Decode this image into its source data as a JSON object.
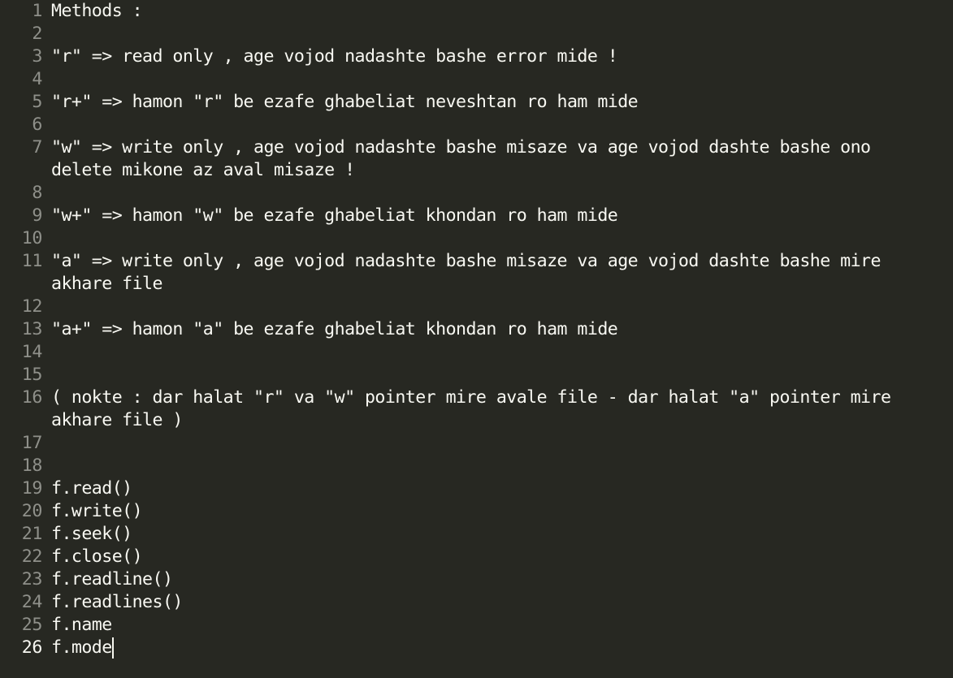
{
  "editor": {
    "lines": [
      {
        "num": "1",
        "text": "Methods :"
      },
      {
        "num": "2",
        "text": ""
      },
      {
        "num": "3",
        "text": "\"r\" => read only , age vojod nadashte bashe error mide !"
      },
      {
        "num": "4",
        "text": ""
      },
      {
        "num": "5",
        "text": "\"r+\" => hamon \"r\" be ezafe ghabeliat neveshtan ro ham mide"
      },
      {
        "num": "6",
        "text": ""
      },
      {
        "num": "7",
        "text": "\"w\" => write only , age vojod nadashte bashe misaze va age vojod dashte bashe ono\ndelete mikone az aval misaze !"
      },
      {
        "num": "8",
        "text": ""
      },
      {
        "num": "9",
        "text": "\"w+\" => hamon \"w\" be ezafe ghabeliat khondan ro ham mide"
      },
      {
        "num": "10",
        "text": ""
      },
      {
        "num": "11",
        "text": "\"a\" => write only , age vojod nadashte bashe misaze va age vojod dashte bashe mire\nakhare file"
      },
      {
        "num": "12",
        "text": ""
      },
      {
        "num": "13",
        "text": "\"a+\" => hamon \"a\" be ezafe ghabeliat khondan ro ham mide"
      },
      {
        "num": "14",
        "text": ""
      },
      {
        "num": "15",
        "text": ""
      },
      {
        "num": "16",
        "text": "( nokte : dar halat \"r\" va \"w\" pointer mire avale file - dar halat \"a\" pointer mire\nakhare file )"
      },
      {
        "num": "17",
        "text": ""
      },
      {
        "num": "18",
        "text": ""
      },
      {
        "num": "19",
        "text": "f.read()"
      },
      {
        "num": "20",
        "text": "f.write()"
      },
      {
        "num": "21",
        "text": "f.seek()"
      },
      {
        "num": "22",
        "text": "f.close()"
      },
      {
        "num": "23",
        "text": "f.readline()"
      },
      {
        "num": "24",
        "text": "f.readlines()"
      },
      {
        "num": "25",
        "text": "f.name"
      },
      {
        "num": "26",
        "text": "f.mode"
      }
    ],
    "active_line": "26"
  },
  "colors": {
    "background": "#272822",
    "text": "#f8f8f2",
    "gutter_text": "#8f908a",
    "gutter_active": "#f8f8f2"
  }
}
